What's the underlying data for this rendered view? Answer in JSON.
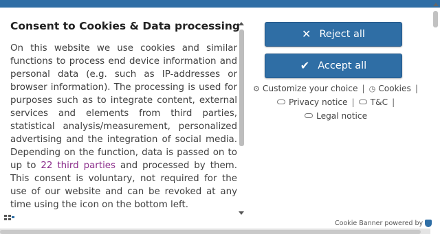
{
  "banner": {
    "title": "Consent to Cookies & Data processing",
    "text_before_link": "On this website we use cookies and similar functions to process end device information and personal data (e.g. such as IP-addresses or browser information). The processing is used for purposes such as to integrate content, external services and elements from third parties, statistical analysis/measurement, personalized advertising and the integration of social media. Depending on the function, data is passed on to up to ",
    "third_parties_link": "22 third parties",
    "text_after_link": " and processed by them. This consent is voluntary, not required for the use of our website and can be revoked at any time using the icon on the bottom left.",
    "buttons": {
      "reject_label": "Reject all",
      "accept_label": "Accept all"
    },
    "links": {
      "customize": "Customize your choice",
      "cookies": "Cookies",
      "privacy": "Privacy notice",
      "tc": "T&C",
      "legal": "Legal notice",
      "separator": "|"
    },
    "powered_by": "Cookie Banner powered by"
  },
  "colors": {
    "accent": "#2f6ea5",
    "link_purple": "#8b2d8b"
  },
  "icons": {
    "reject": "close-icon",
    "accept": "checkmark-icon",
    "customize": "gear-icon",
    "cookies": "cookie-icon",
    "privacy": "link-icon",
    "tc": "link-icon",
    "legal": "link-icon",
    "powered_by": "shield-icon",
    "floating": "cookie-settings-icon"
  }
}
